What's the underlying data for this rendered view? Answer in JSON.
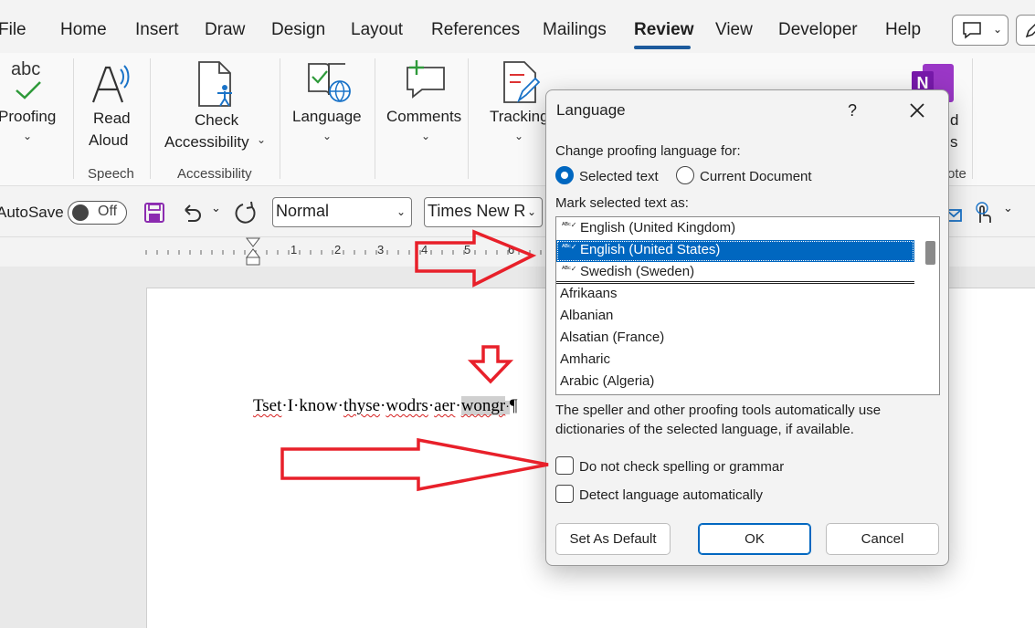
{
  "menu": {
    "tabs": [
      "File",
      "Home",
      "Insert",
      "Draw",
      "Design",
      "Layout",
      "References",
      "Mailings",
      "Review",
      "View",
      "Developer",
      "Help"
    ],
    "active": "Review"
  },
  "ribbon": {
    "proofing": "Proofing",
    "read_aloud_1": "Read",
    "read_aloud_2": "Aloud",
    "check_1": "Check",
    "check_2": "Accessibility",
    "language": "Language",
    "comments": "Comments",
    "tracking": "Tracking",
    "group_speech": "Speech",
    "group_accessibility": "Accessibility",
    "group_onenote_partial": "ote",
    "partial_d": "d",
    "partial_s": "s",
    "abc": "abc",
    "onenote_letter": "N"
  },
  "toolbar": {
    "autosave": "AutoSave",
    "toggle_state": "Off",
    "style": "Normal",
    "font": "Times New R"
  },
  "ruler": {
    "numbers": [
      "1",
      "2",
      "3",
      "4",
      "5",
      "6"
    ]
  },
  "document": {
    "w1": "Tset",
    "w2": "I",
    "w3": "know",
    "w4": "thyse",
    "w5": "wodrs",
    "w6": "aer",
    "w7": "wongr",
    "pilcrow": "¶"
  },
  "dialog": {
    "title": "Language",
    "help": "?",
    "change_label": "Change proofing language for:",
    "radio_selected": "Selected text",
    "radio_document": "Current Document",
    "mark_label": "Mark selected text as:",
    "languages": [
      "English (United Kingdom)",
      "English (United States)",
      "Swedish (Sweden)",
      "Afrikaans",
      "Albanian",
      "Alsatian (France)",
      "Amharic",
      "Arabic (Algeria)"
    ],
    "selected_language": "English (United States)",
    "info_1": "The speller and other proofing tools automatically use",
    "info_2": "dictionaries of the selected language, if available.",
    "chk_no_spell": "Do not check spelling or grammar",
    "chk_detect": "Detect language automatically",
    "btn_default": "Set As Default",
    "btn_ok": "OK",
    "btn_cancel": "Cancel"
  },
  "colors": {
    "accent": "#0067c0",
    "review_underline": "#1c5a9c",
    "annotation_arrow": "#e8202a"
  }
}
